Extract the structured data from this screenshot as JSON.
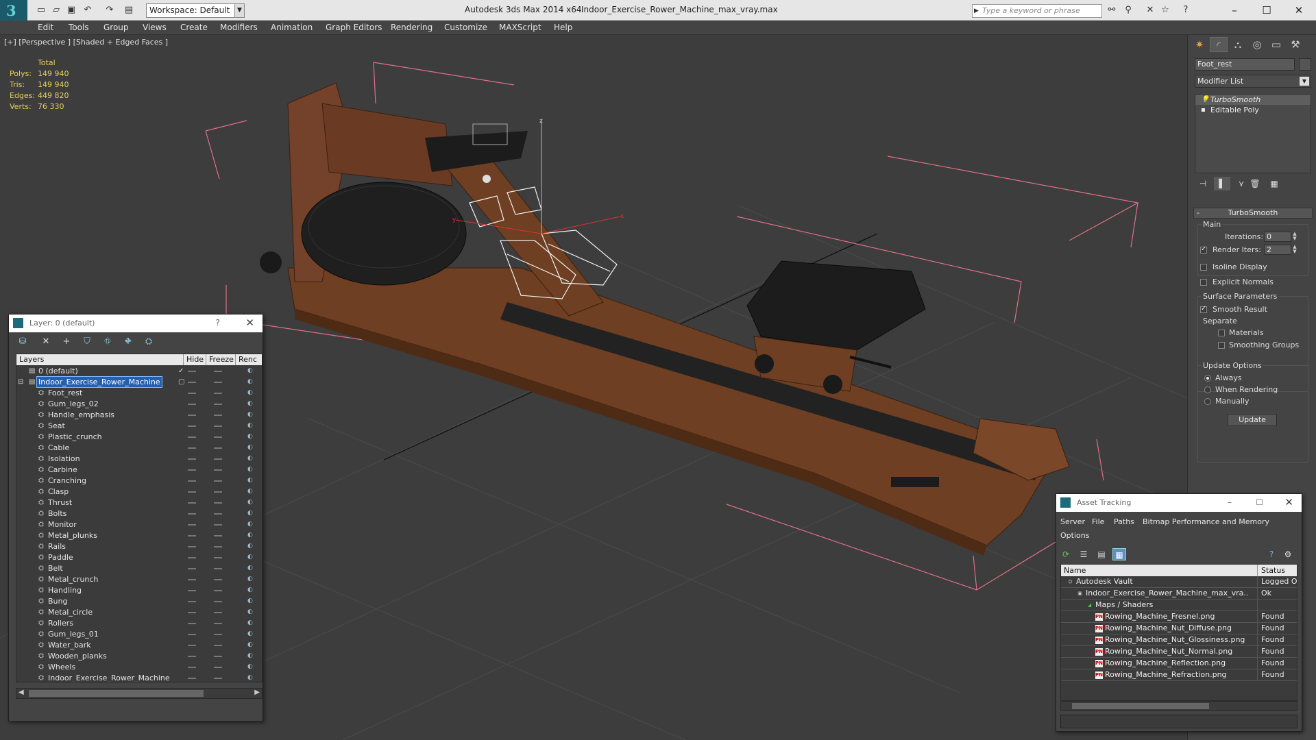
{
  "titlebar": {
    "workspace": "Workspace: Default",
    "app_title": "Autodesk 3ds Max  2014 x64",
    "file_title": "Indoor_Exercise_Rower_Machine_max_vray.max",
    "search_placeholder": "Type a keyword or phrase"
  },
  "menu": [
    "Edit",
    "Tools",
    "Group",
    "Views",
    "Create",
    "Modifiers",
    "Animation",
    "Graph Editors",
    "Rendering",
    "Customize",
    "MAXScript",
    "Help"
  ],
  "viewport": {
    "label": "[+] [Perspective ] [Shaded + Edged Faces ]",
    "stats": {
      "header": "Total",
      "rows": [
        {
          "label": "Polys:",
          "value": "149 940"
        },
        {
          "label": "Tris:",
          "value": "149 940"
        },
        {
          "label": "Edges:",
          "value": "449 820"
        },
        {
          "label": "Verts:",
          "value": "76 330"
        }
      ]
    },
    "colors": {
      "stats": "#e8d060",
      "wood": "#6e3f22",
      "bbox": "#e0708a"
    }
  },
  "command_panel": {
    "object_name": "Foot_rest",
    "modifier_list": "Modifier List",
    "stack": [
      "TurboSmooth",
      "Editable Poly"
    ],
    "rollout_title": "TurboSmooth",
    "main_group": "Main",
    "iterations_label": "Iterations:",
    "iterations_value": "0",
    "render_iters_label": "Render Iters:",
    "render_iters_value": "2",
    "isoline": "Isoline Display",
    "explicit": "Explicit Normals",
    "surface_group": "Surface Parameters",
    "smooth_result": "Smooth Result",
    "separate": "Separate",
    "materials": "Materials",
    "smoothing_groups": "Smoothing Groups",
    "update_group": "Update Options",
    "always": "Always",
    "when_rendering": "When Rendering",
    "manually": "Manually",
    "update_btn": "Update"
  },
  "layer_dialog": {
    "title": "Layer: 0 (default)",
    "help": "?",
    "headers": [
      "Layers",
      "Hide",
      "Freeze",
      "Renc"
    ],
    "default_layer": "0 (default)",
    "main_layer": "Indoor_Exercise_Rower_Machine",
    "children": [
      "Foot_rest",
      "Gum_legs_02",
      "Handle_emphasis",
      "Seat",
      "Plastic_crunch",
      "Cable",
      "Isolation",
      "Carbine",
      "Cranching",
      "Clasp",
      "Thrust",
      "Bolts",
      "Monitor",
      "Metal_plunks",
      "Rails",
      "Paddle",
      "Belt",
      "Metal_crunch",
      "Handling",
      "Bung",
      "Metal_circle",
      "Rollers",
      "Gum_legs_01",
      "Water_bark",
      "Wooden_planks",
      "Wheels",
      "Indoor_Exercise_Rower_Machine"
    ]
  },
  "asset_dialog": {
    "title": "Asset Tracking",
    "menu": [
      "Server",
      "File",
      "Paths",
      "Bitmap Performance and Memory",
      "Options"
    ],
    "headers": [
      "Name",
      "Status"
    ],
    "rows": [
      {
        "name": "Autodesk Vault",
        "status": "Logged Ou",
        "indent": 0,
        "icon": "vault"
      },
      {
        "name": "Indoor_Exercise_Rower_Machine_max_vra...",
        "status": "Ok",
        "indent": 1,
        "icon": "max"
      },
      {
        "name": "Maps / Shaders",
        "status": "",
        "indent": 2,
        "icon": "maps"
      },
      {
        "name": "Rowing_Machine_Fresnel.png",
        "status": "Found",
        "indent": 3,
        "icon": "png"
      },
      {
        "name": "Rowing_Machine_Nut_Diffuse.png",
        "status": "Found",
        "indent": 3,
        "icon": "png"
      },
      {
        "name": "Rowing_Machine_Nut_Glossiness.png",
        "status": "Found",
        "indent": 3,
        "icon": "png"
      },
      {
        "name": "Rowing_Machine_Nut_Normal.png",
        "status": "Found",
        "indent": 3,
        "icon": "png"
      },
      {
        "name": "Rowing_Machine_Reflection.png",
        "status": "Found",
        "indent": 3,
        "icon": "png"
      },
      {
        "name": "Rowing_Machine_Refraction.png",
        "status": "Found",
        "indent": 3,
        "icon": "png"
      }
    ]
  }
}
